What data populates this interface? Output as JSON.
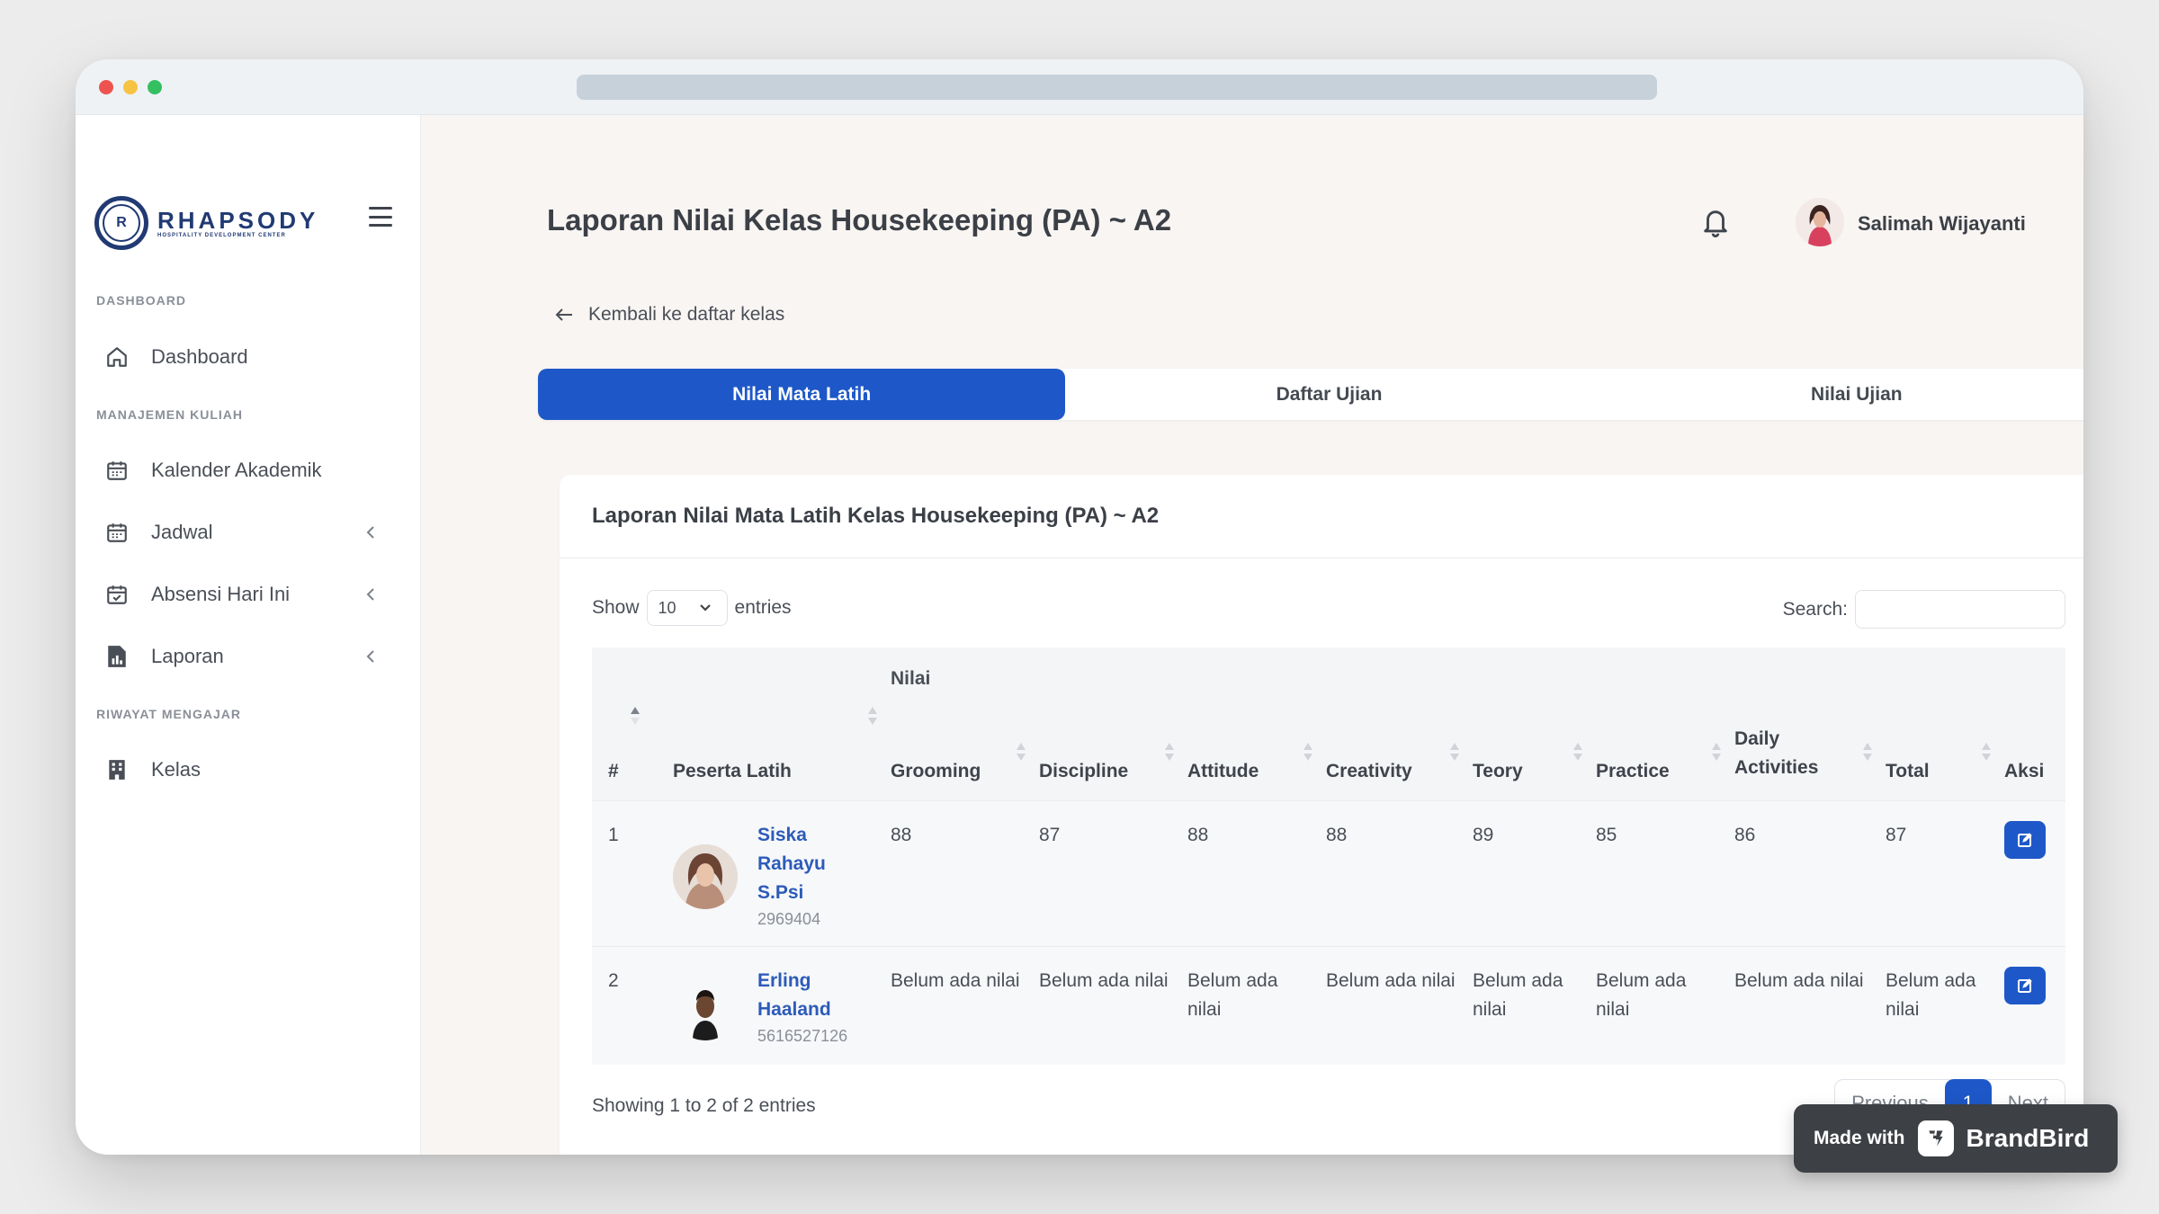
{
  "logo": {
    "name": "RHAPSODY",
    "subtitle": "HOSPITALITY DEVELOPMENT CENTER",
    "mark": "R"
  },
  "sidebar": {
    "sections": [
      {
        "title": "DASHBOARD"
      },
      {
        "title": "MANAJEMEN KULIAH"
      },
      {
        "title": "RIWAYAT MENGAJAR"
      }
    ],
    "items": [
      {
        "label": "Dashboard",
        "icon": "home-icon"
      },
      {
        "label": "Kalender Akademik",
        "icon": "calendar-icon"
      },
      {
        "label": "Jadwal",
        "icon": "calendar-grid-icon",
        "has_submenu": true
      },
      {
        "label": "Absensi Hari Ini",
        "icon": "calendar-check-icon",
        "has_submenu": true
      },
      {
        "label": "Laporan",
        "icon": "report-icon",
        "has_submenu": true
      },
      {
        "label": "Kelas",
        "icon": "building-icon"
      }
    ]
  },
  "header": {
    "title": "Laporan Nilai Kelas Housekeeping (PA) ~ A2",
    "user_name": "Salimah Wijayanti"
  },
  "back_link": "Kembali ke daftar kelas",
  "tabs": [
    {
      "label": "Nilai Mata Latih",
      "active": true
    },
    {
      "label": "Daftar Ujian",
      "active": false
    },
    {
      "label": "Nilai Ujian",
      "active": false
    }
  ],
  "card": {
    "title": "Laporan Nilai Mata Latih Kelas Housekeeping (PA) ~ A2",
    "show_label": "Show",
    "entries_label": "entries",
    "page_length": "10",
    "search_label": "Search:",
    "search_value": ""
  },
  "table": {
    "group_header": "Nilai",
    "columns": [
      "#",
      "Peserta Latih",
      "Grooming",
      "Discipline",
      "Attitude",
      "Creativity",
      "Teory",
      "Practice",
      "Daily Activities",
      "Total",
      "Aksi"
    ],
    "rows": [
      {
        "num": "1",
        "name": "Siska Rahayu S.Psi",
        "id": "2969404",
        "values": [
          "88",
          "87",
          "88",
          "88",
          "89",
          "85",
          "86",
          "87"
        ]
      },
      {
        "num": "2",
        "name": "Erling Haaland",
        "id": "5616527126",
        "values": [
          "Belum ada nilai",
          "Belum ada nilai",
          "Belum ada nilai",
          "Belum ada nilai",
          "Belum ada nilai",
          "Belum ada nilai",
          "Belum ada nilai",
          "Belum ada nilai"
        ]
      }
    ]
  },
  "footer": {
    "info": "Showing 1 to 2 of 2 entries",
    "previous": "Previous",
    "current_page": "1",
    "next": "Next"
  },
  "badge": {
    "made_with": "Made with",
    "brand": "BrandBird"
  },
  "colors": {
    "accent": "#1e58c8",
    "brand": "#213a73",
    "link": "#2d5bb9"
  }
}
